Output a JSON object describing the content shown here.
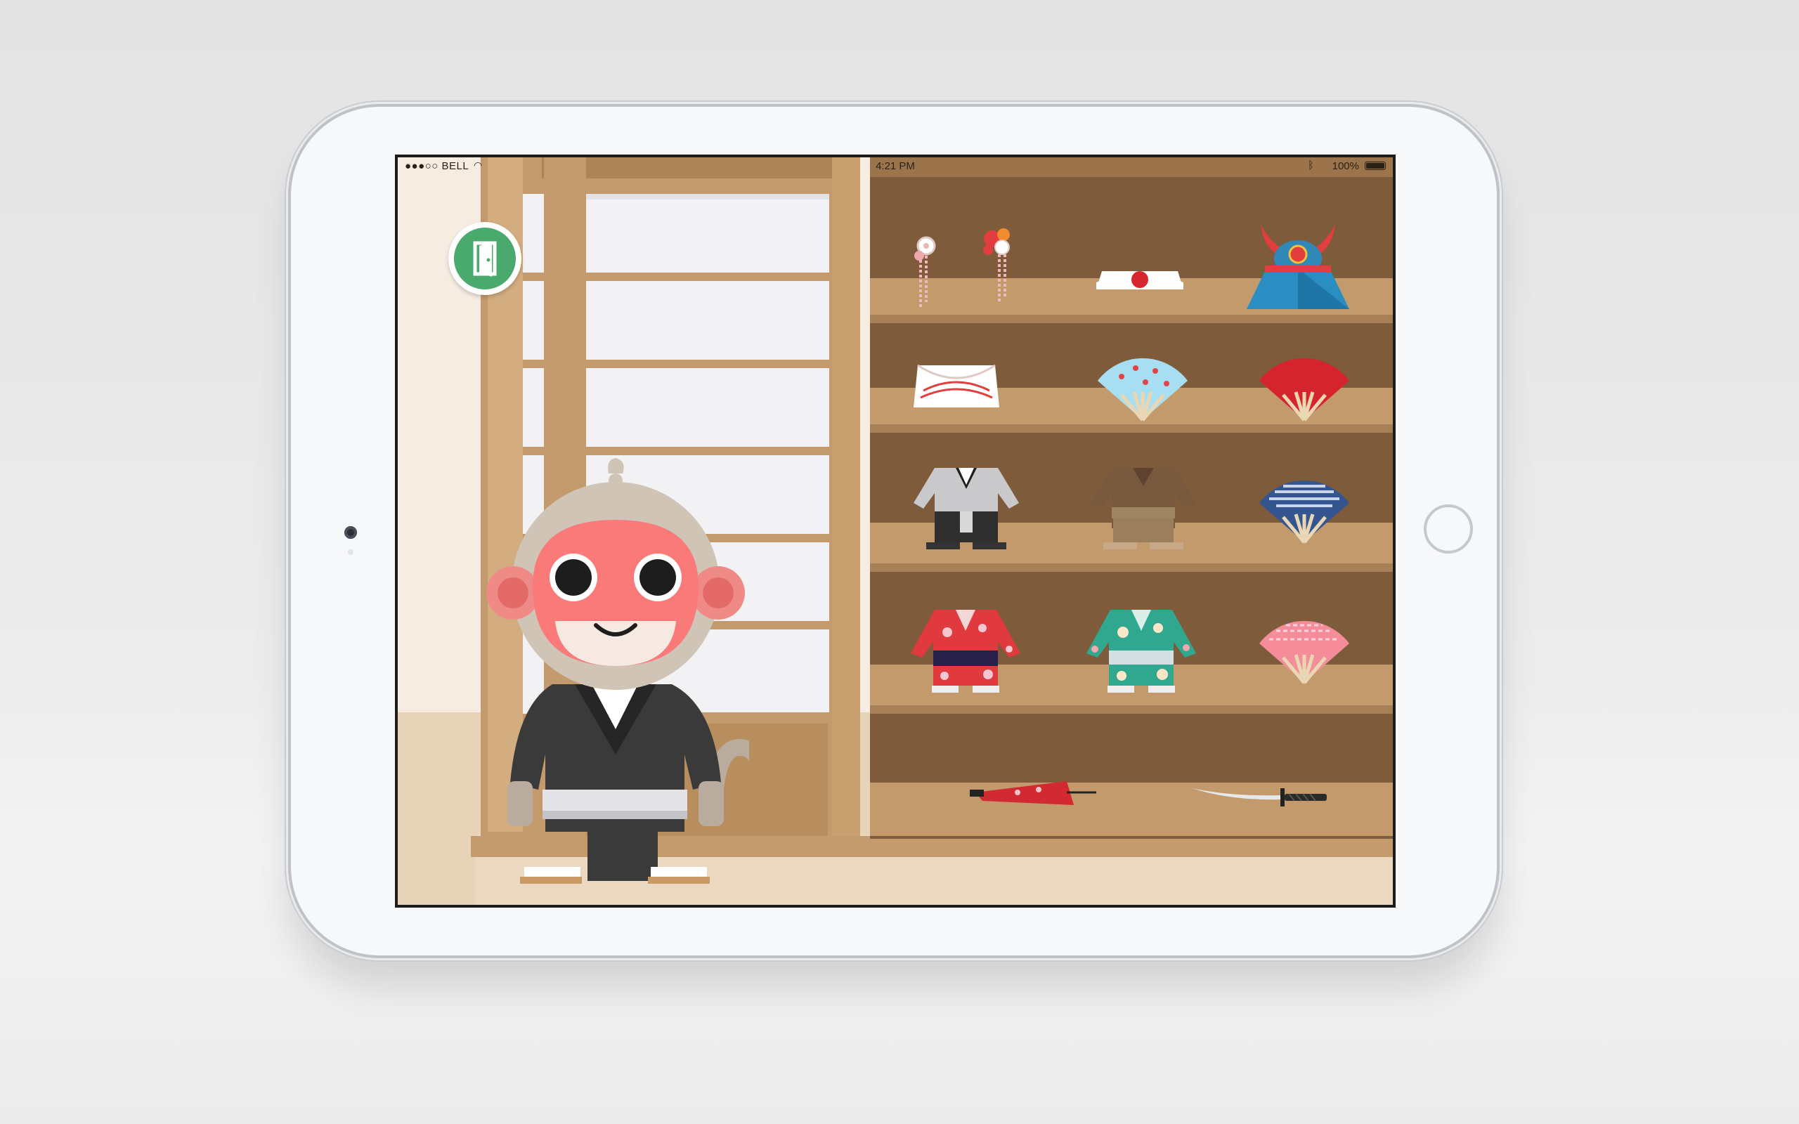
{
  "status_bar": {
    "signal_dots": "●●●○○",
    "carrier": "BELL",
    "time": "4:21 PM",
    "bluetooth_icon": "bluetooth-icon",
    "battery_percent": "100%"
  },
  "exit_button": {
    "icon": "exit-door-icon",
    "color": "#4aa96c"
  },
  "character": {
    "name": "monkey",
    "outfit": "black-gi"
  },
  "shelves": [
    {
      "items": [
        "hairpin-white",
        "hairpin-red",
        "hachimaki-headband",
        "samurai-helmet"
      ]
    },
    {
      "items": [
        "tenugui-headband",
        "fan-blue",
        "fan-red"
      ]
    },
    {
      "items": [
        "outfit-grey-hakama",
        "outfit-brown",
        "fan-navy-pattern"
      ]
    },
    {
      "items": [
        "kimono-red",
        "kimono-teal",
        "fan-pink"
      ]
    },
    {
      "items": [
        "parasol-red",
        "katana-sword"
      ]
    }
  ],
  "colors": {
    "wood_light": "#c39a6b",
    "wood_dark": "#7e5b3b",
    "shelf_plank": "#b99163",
    "wall": "#f6ece2",
    "floor": "#e6d3b8"
  }
}
